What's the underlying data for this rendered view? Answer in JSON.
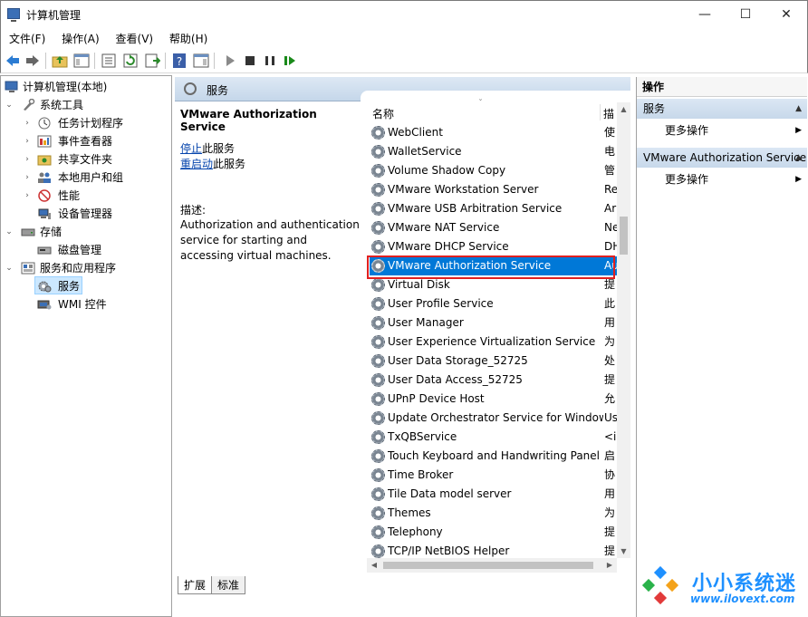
{
  "window": {
    "title": "计算机管理",
    "controls": {
      "minimize": "—",
      "maximize": "☐",
      "close": "✕"
    }
  },
  "menu": [
    "文件(F)",
    "操作(A)",
    "查看(V)",
    "帮助(H)"
  ],
  "toolbar": [
    "back-arrow-icon",
    "forward-arrow-icon",
    "up-folder-icon",
    "show-hide-tree-icon",
    "properties-icon",
    "refresh-icon",
    "export-list-icon",
    "help-icon",
    "show-hide-action-icon",
    "start-service-icon",
    "stop-service-icon",
    "pause-service-icon",
    "resume-service-icon"
  ],
  "tree": {
    "root": "计算机管理(本地)",
    "system_tools": "系统工具",
    "task_scheduler": "任务计划程序",
    "event_viewer": "事件查看器",
    "shared_folders": "共享文件夹",
    "local_users": "本地用户和组",
    "performance": "性能",
    "device_manager": "设备管理器",
    "storage": "存储",
    "disk_management": "磁盘管理",
    "services_apps": "服务和应用程序",
    "services": "服务",
    "wmi": "WMI 控件"
  },
  "main": {
    "header_title": "服务",
    "selected_service": "VMware Authorization Service",
    "stop_link": "停止",
    "stop_suffix": "此服务",
    "restart_link": "重启动",
    "restart_suffix": "此服务",
    "desc_label": "描述:",
    "description": "Authorization and authentication service for starting and accessing virtual machines.",
    "col_name": "名称",
    "col_desc": "描",
    "sort_glyph": "ˇ",
    "services": [
      {
        "name": "WebClient",
        "desc": "使"
      },
      {
        "name": "WalletService",
        "desc": "电"
      },
      {
        "name": "Volume Shadow Copy",
        "desc": "管"
      },
      {
        "name": "VMware Workstation Server",
        "desc": "Re"
      },
      {
        "name": "VMware USB Arbitration Service",
        "desc": "Ar"
      },
      {
        "name": "VMware NAT Service",
        "desc": "Ne"
      },
      {
        "name": "VMware DHCP Service",
        "desc": "DH"
      },
      {
        "name": "VMware Authorization Service",
        "desc": "Au"
      },
      {
        "name": "Virtual Disk",
        "desc": "提"
      },
      {
        "name": "User Profile Service",
        "desc": "此"
      },
      {
        "name": "User Manager",
        "desc": "用"
      },
      {
        "name": "User Experience Virtualization Service",
        "desc": "为"
      },
      {
        "name": "User Data Storage_52725",
        "desc": "处"
      },
      {
        "name": "User Data Access_52725",
        "desc": "提"
      },
      {
        "name": "UPnP Device Host",
        "desc": "允"
      },
      {
        "name": "Update Orchestrator Service for Windows Update",
        "desc": "Us"
      },
      {
        "name": "TxQBService",
        "desc": "<i"
      },
      {
        "name": "Touch Keyboard and Handwriting Panel Service",
        "desc": "启"
      },
      {
        "name": "Time Broker",
        "desc": "协"
      },
      {
        "name": "Tile Data model server",
        "desc": "用"
      },
      {
        "name": "Themes",
        "desc": "为"
      },
      {
        "name": "Telephony",
        "desc": "提"
      },
      {
        "name": "TCP/IP NetBIOS Helper",
        "desc": "提"
      }
    ],
    "selected_index": 7,
    "tabs": {
      "extended": "扩展",
      "standard": "标准"
    }
  },
  "actions": {
    "title": "操作",
    "group1": "服务",
    "group1_more": "更多操作",
    "group2": "VMware Authorization Service",
    "group2_more": "更多操作"
  },
  "watermark": {
    "brand": "小小系统迷",
    "url": "www.ilovext.com"
  },
  "colors": {
    "selection": "#0078d7",
    "highlight_box": "#e02020",
    "link": "#0645ad",
    "watermark": "#1e90ff"
  }
}
